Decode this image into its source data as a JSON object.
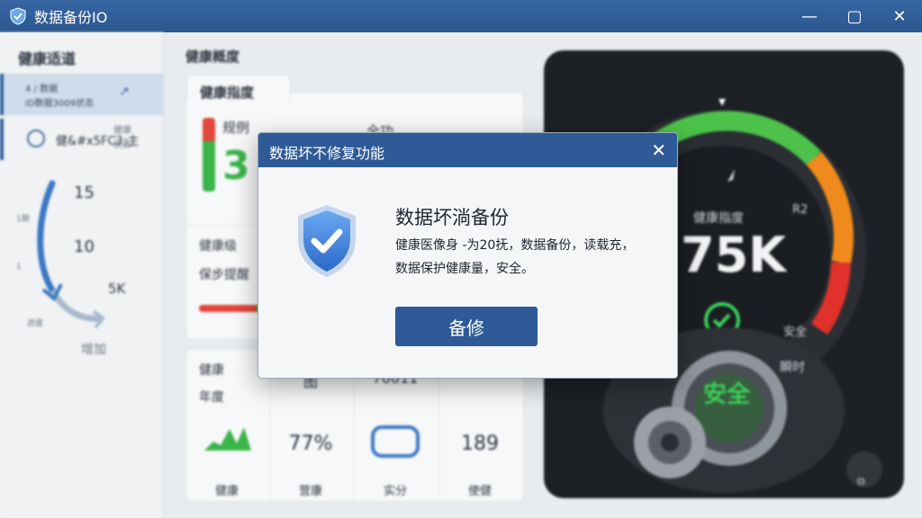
{
  "window": {
    "title": "数据备份IO",
    "minimize": "—",
    "maximize": "▢",
    "close": "✕"
  },
  "sidebar": {
    "title": "健康适道",
    "item1_line1": "4 / 数据",
    "item1_line2": "ID数据3009状态",
    "item1_arrow": "↗",
    "item2_label": "健&#x5FC3;主",
    "item2_hint1": "健康",
    "item2_hint2": "状态",
    "dial_values": [
      "15",
      "10",
      "5K"
    ],
    "dial_ticks": [
      "1期",
      "1",
      "进度"
    ],
    "dial_caption": "增加"
  },
  "main": {
    "title": "健康概度",
    "card1": {
      "tab": "健康指度",
      "label_a": "规例",
      "big_value": "3",
      "label_b": "全功"
    },
    "card2": {
      "title": "健康级",
      "subtitle": "保步提醒"
    },
    "card3": {
      "title_a": "健康",
      "title_b": "年度",
      "top_labels": [
        "",
        "图",
        "70011",
        ""
      ],
      "values": [
        "",
        "77%",
        "",
        "189"
      ],
      "footers": [
        "健康",
        "营康",
        "实分",
        "使健"
      ]
    }
  },
  "gauge": {
    "label": "健康指度",
    "value": "75K",
    "tick_r2": "R2",
    "tick_bottom": "安全",
    "side_label": "瞬时",
    "knob_text": "安全",
    "level": 0.75,
    "colors": {
      "green": "#4cc24a",
      "orange": "#f08a1c",
      "red": "#e0312a"
    }
  },
  "dialog": {
    "title": "数据坏不修复功能",
    "close": "✕",
    "heading": "数据坏淌备份",
    "body_line1": "健康医像身 -为20抚，数据备份，读载充，",
    "body_line2": "数据保护健康量，安全。",
    "button": "备修",
    "icon": "shield-check-icon"
  }
}
